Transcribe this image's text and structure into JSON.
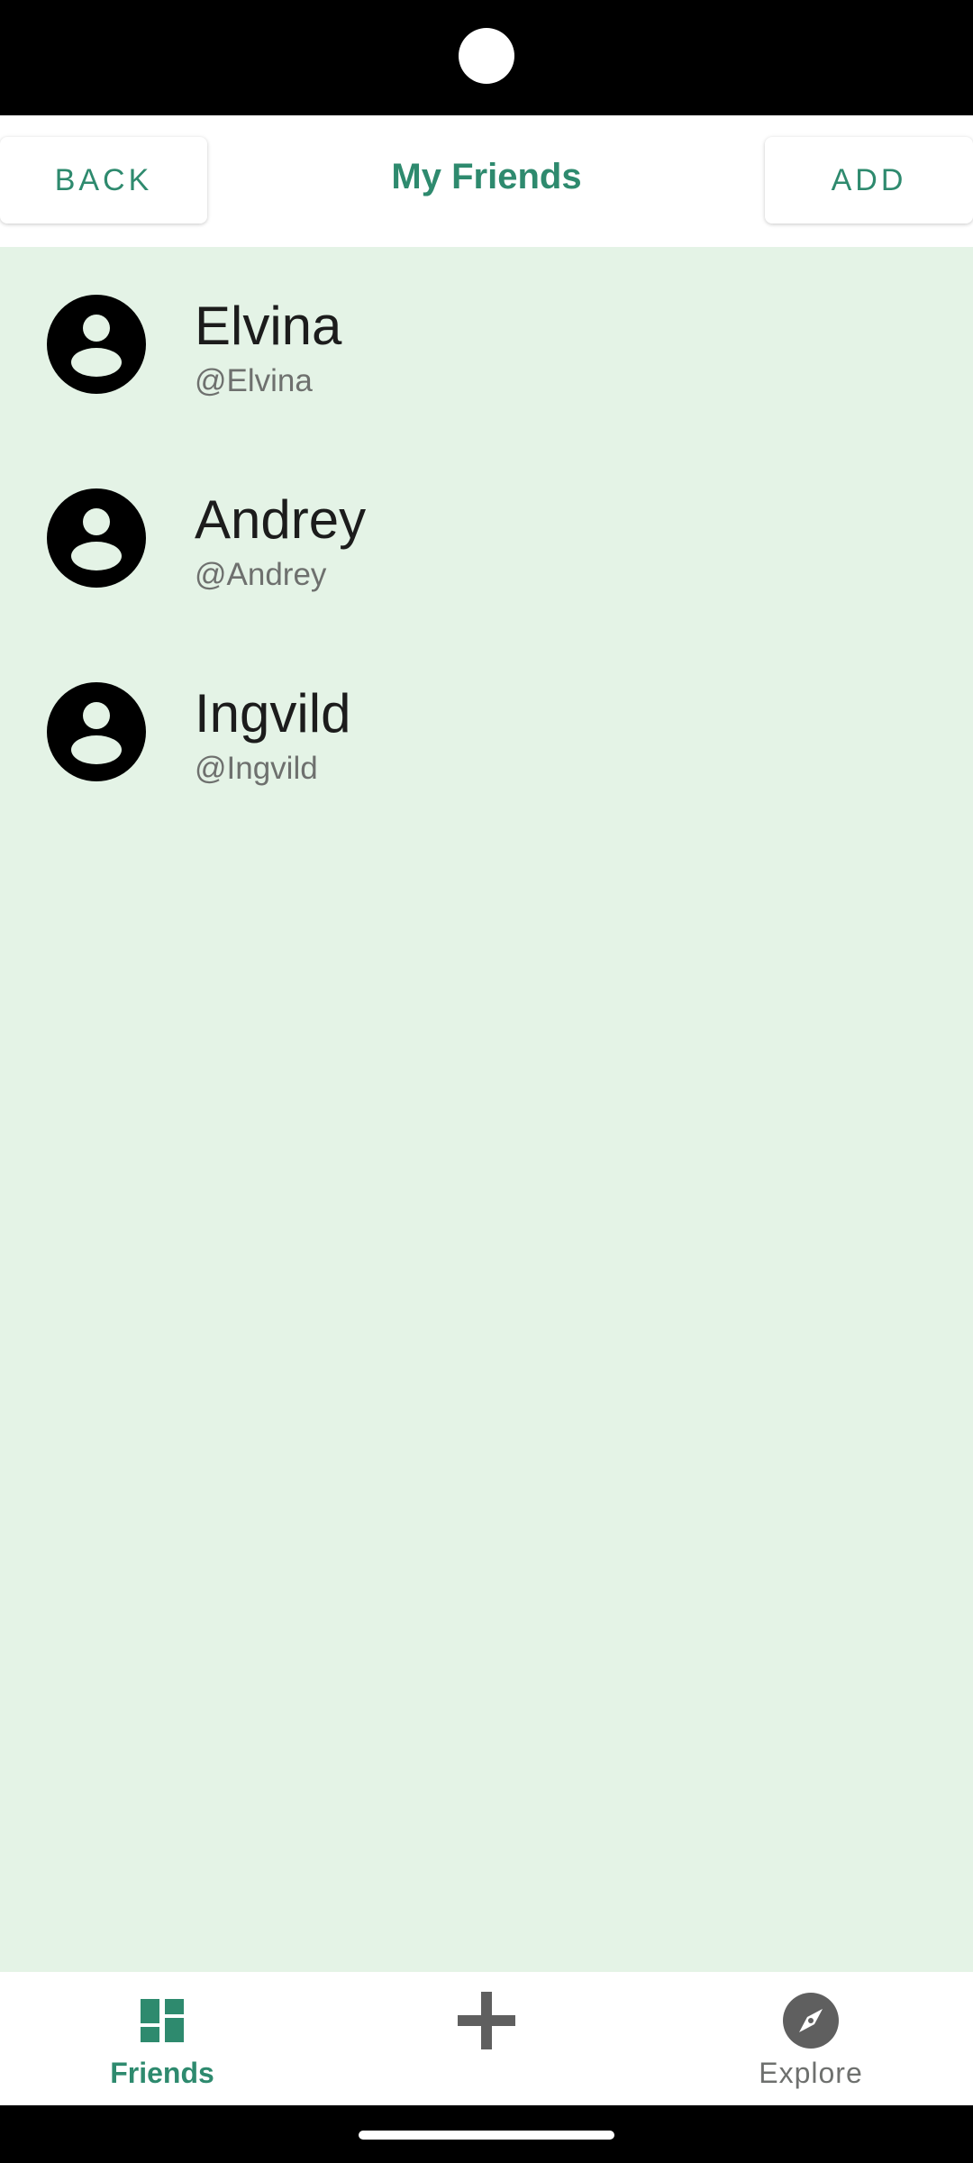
{
  "app_bar": {
    "back_label": "BACK",
    "title": "My Friends",
    "add_label": "ADD"
  },
  "friends": [
    {
      "name": "Elvina",
      "handle": "@Elvina"
    },
    {
      "name": "Andrey",
      "handle": "@Andrey"
    },
    {
      "name": "Ingvild",
      "handle": "@Ingvild"
    }
  ],
  "bottom_nav": {
    "friends_label": "Friends",
    "explore_label": "Explore",
    "friends_icon": "dashboard-icon",
    "add_icon": "plus-icon",
    "explore_icon": "compass-icon"
  },
  "colors": {
    "accent": "#2e8a6e",
    "list_background": "#e4f3e6",
    "muted_text": "#6e706e"
  }
}
